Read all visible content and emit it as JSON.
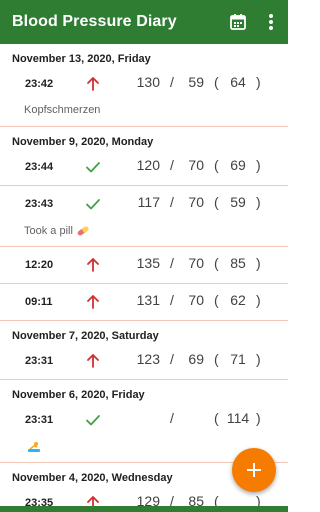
{
  "app": {
    "title": "Blood Pressure Diary",
    "icons": {
      "calendar": "calendar-icon",
      "more": "more-vertical-icon",
      "add": "plus-icon"
    },
    "colors": {
      "appbar": "#2e7d32",
      "fab": "#f57c00",
      "up_arrow": "#d32f2f",
      "check": "#43a047",
      "divider": "#f3c7b7"
    }
  },
  "days": [
    {
      "date": "November 13, 2020,  Friday",
      "entries": [
        {
          "time": "23:42",
          "status": "up",
          "sys": "130",
          "dia": "59",
          "pulse": "64",
          "note": "Kopfschmerzen"
        }
      ]
    },
    {
      "date": "November 9, 2020,  Monday",
      "entries": [
        {
          "time": "23:44",
          "status": "ok",
          "sys": "120",
          "dia": "70",
          "pulse": "69"
        },
        {
          "time": "23:43",
          "status": "ok",
          "sys": "117",
          "dia": "70",
          "pulse": "59",
          "note": "Took a pill",
          "note_icon": "pill-icon"
        },
        {
          "time": "12:20",
          "status": "up",
          "sys": "135",
          "dia": "70",
          "pulse": "85"
        },
        {
          "time": "09:11",
          "status": "up",
          "sys": "131",
          "dia": "70",
          "pulse": "62"
        }
      ]
    },
    {
      "date": "November 7, 2020,  Saturday",
      "entries": [
        {
          "time": "23:31",
          "status": "up",
          "sys": "123",
          "dia": "69",
          "pulse": "71"
        }
      ]
    },
    {
      "date": "November 6, 2020,  Friday",
      "entries": [
        {
          "time": "23:31",
          "status": "ok",
          "sys": "",
          "dia": "",
          "pulse": "114",
          "note": "",
          "note_icon": "swimmer-icon"
        }
      ]
    },
    {
      "date": "November 4, 2020,  Wednesday",
      "entries": [
        {
          "time": "23:35",
          "status": "up",
          "sys": "129",
          "dia": "85",
          "pulse": ""
        }
      ]
    }
  ]
}
